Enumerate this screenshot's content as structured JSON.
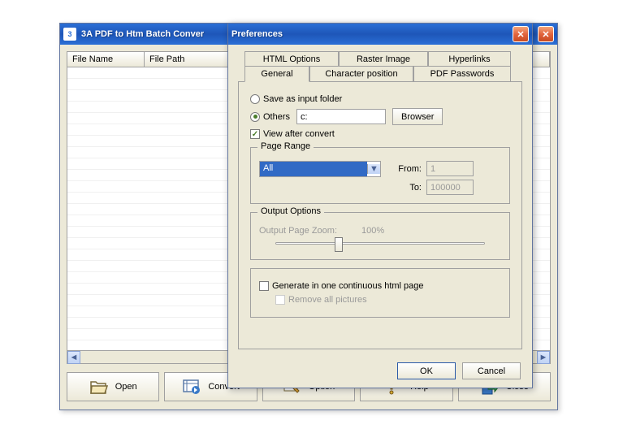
{
  "main": {
    "title": "3A PDF to Htm Batch Conver",
    "columns": {
      "name": "File Name",
      "path": "File Path"
    },
    "buttons": {
      "open": "Open",
      "convert": "Convert",
      "option": "Option",
      "help": "Help",
      "close": "Close"
    }
  },
  "pref": {
    "title": "Preferences",
    "tabs": {
      "html": "HTML Options",
      "raster": "Raster Image",
      "hyperlink": "Hyperlinks",
      "general": "General",
      "charpos": "Character position",
      "passwords": "PDF Passwords"
    },
    "general": {
      "save_as_input": "Save as input folder",
      "others": "Others",
      "others_value": "c:",
      "browser": "Browser",
      "view_after": "View after convert",
      "page_range": {
        "legend": "Page Range",
        "select_value": "All",
        "from_label": "From:",
        "from_value": "1",
        "to_label": "To:",
        "to_value": "100000"
      },
      "output": {
        "legend": "Output Options",
        "zoom_label": "Output Page Zoom:",
        "zoom_value": "100%"
      },
      "continuous": "Generate in one continuous html page",
      "remove_pics": "Remove all pictures"
    },
    "buttons": {
      "ok": "OK",
      "cancel": "Cancel"
    }
  }
}
